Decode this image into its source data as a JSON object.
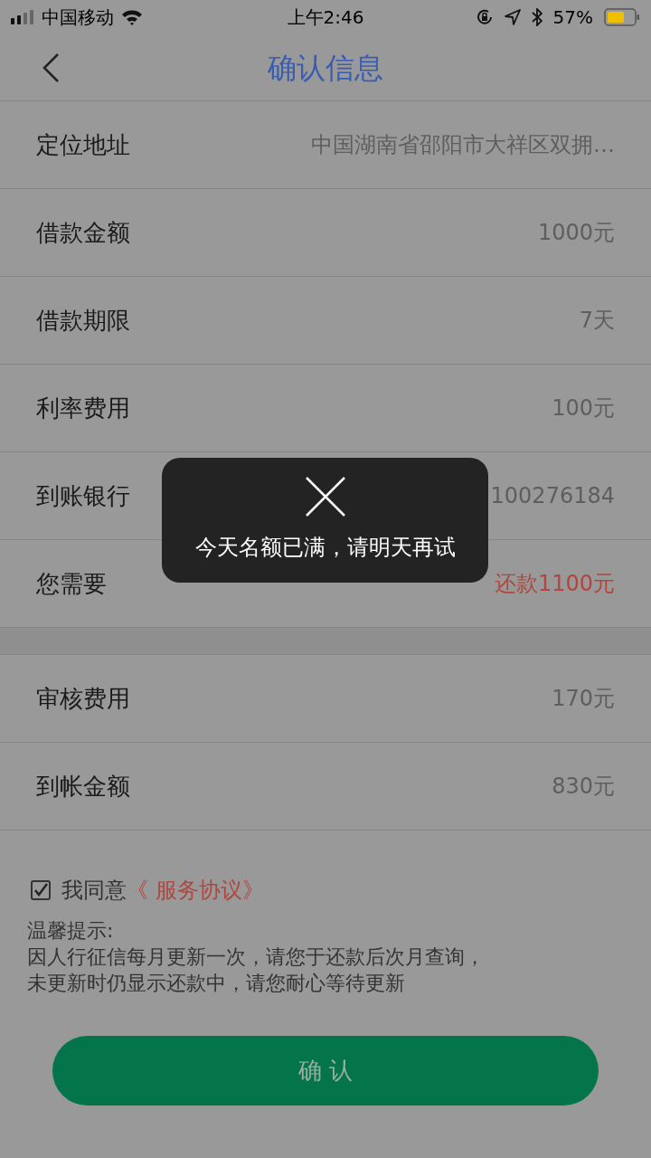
{
  "status_bar": {
    "carrier": "中国移动",
    "time": "上午2:46",
    "battery": "57%"
  },
  "nav": {
    "title": "确认信息"
  },
  "rows": [
    {
      "label": "定位地址",
      "value": "中国湖南省邵阳市大祥区双拥…",
      "kind": "normal"
    },
    {
      "label": "借款金额",
      "value": "1000元",
      "kind": "normal"
    },
    {
      "label": "借款期限",
      "value": "7天",
      "kind": "normal"
    },
    {
      "label": "利率费用",
      "value": "100元",
      "kind": "normal"
    },
    {
      "label": "到账银行",
      "value": "100276184",
      "kind": "normal"
    },
    {
      "label": "您需要",
      "value": "还款1100元",
      "kind": "alert"
    }
  ],
  "fee_rows": [
    {
      "label": "审核费用",
      "value": "170元"
    },
    {
      "label": "到帐金额",
      "value": "830元"
    }
  ],
  "agreement": {
    "checked": true,
    "label": "我同意",
    "link": "《 服务协议》"
  },
  "tips": {
    "title": "温馨提示:",
    "lines": [
      "因人行征信每月更新一次，请您于还款后次月查询，",
      "未更新时仍显示还款中，请您耐心等待更新"
    ]
  },
  "confirm_button": {
    "label": "确 认"
  },
  "toast": {
    "message": "今天名额已满，请明天再试"
  }
}
